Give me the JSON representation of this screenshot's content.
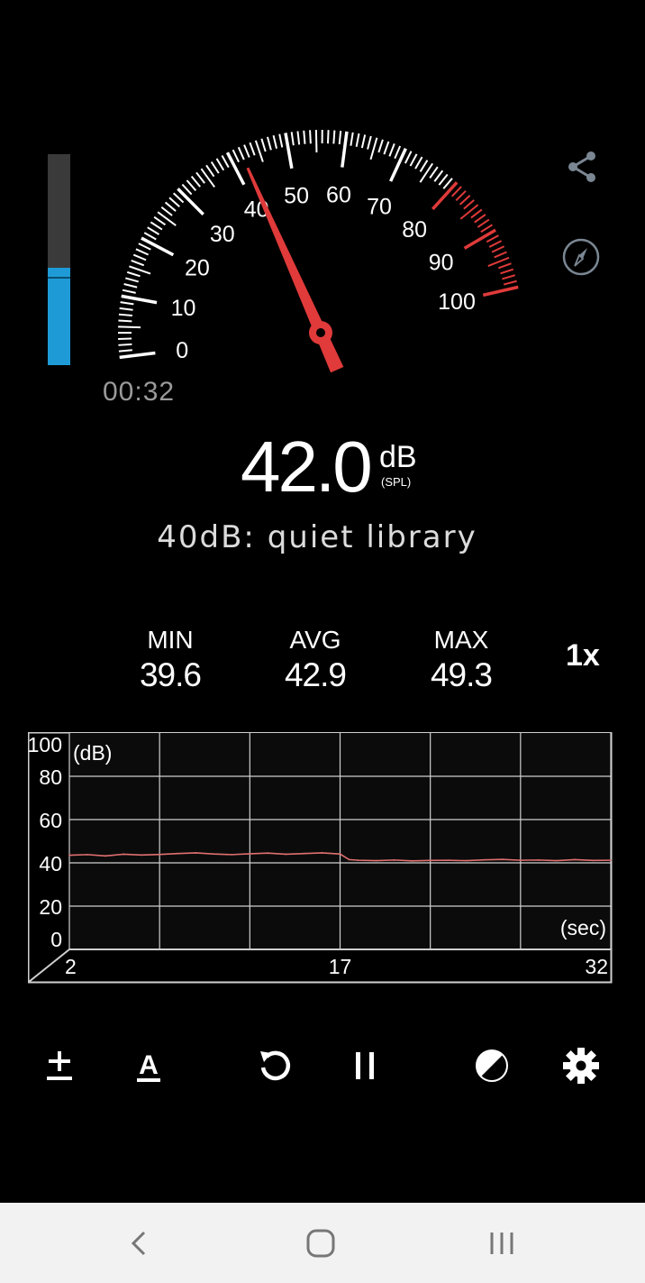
{
  "meter": {
    "timer": "00:32",
    "value": "42.0",
    "unit": "dB",
    "unit_sub": "(SPL)",
    "description": "40dB: quiet library",
    "level_fraction": 0.46,
    "level_mark_fraction": 0.41
  },
  "gauge": {
    "min": 0,
    "max": 100,
    "needle_value": 42.0,
    "labels": [
      "0",
      "10",
      "20",
      "30",
      "40",
      "50",
      "60",
      "70",
      "80",
      "90",
      "100"
    ],
    "red_zone_start": 80,
    "tick_color": "#ffffff",
    "red_color": "#e03a3a"
  },
  "stats": {
    "min_label": "MIN",
    "min_value": "39.6",
    "avg_label": "AVG",
    "avg_value": "42.9",
    "max_label": "MAX",
    "max_value": "49.3",
    "speed": "1x"
  },
  "chart_data": {
    "type": "line",
    "xlabel": "(sec)",
    "ylabel": "(dB)",
    "ylim": [
      0,
      100
    ],
    "xlim": [
      2,
      32
    ],
    "y_ticks": [
      "100",
      "80",
      "60",
      "40",
      "20",
      "0"
    ],
    "x_ticks": [
      "2",
      "17",
      "32"
    ],
    "grid": true,
    "series": [
      {
        "color": "#e07070",
        "x": [
          2,
          3,
          4,
          5,
          6,
          7,
          8,
          9,
          10,
          11,
          12,
          13,
          14,
          15,
          16,
          17,
          17.5,
          18,
          19,
          20,
          21,
          22,
          23,
          24,
          25,
          26,
          27,
          28,
          29,
          30,
          31,
          32
        ],
        "y": [
          43.5,
          43.8,
          43.2,
          44.0,
          43.6,
          43.9,
          44.3,
          44.6,
          44.1,
          43.8,
          44.2,
          44.5,
          44.0,
          44.3,
          44.6,
          44.1,
          41.5,
          41.2,
          41.0,
          41.3,
          40.9,
          41.1,
          41.2,
          41.0,
          41.4,
          41.6,
          41.2,
          41.3,
          41.0,
          41.5,
          41.1,
          41.2
        ]
      }
    ]
  },
  "toolbar": {
    "calibrate_icon": "plus-minus-icon",
    "font_icon": "text-format-icon",
    "reset_icon": "reset-icon",
    "pause_icon": "pause-icon",
    "theme_icon": "contrast-icon",
    "settings_icon": "gear-icon"
  }
}
